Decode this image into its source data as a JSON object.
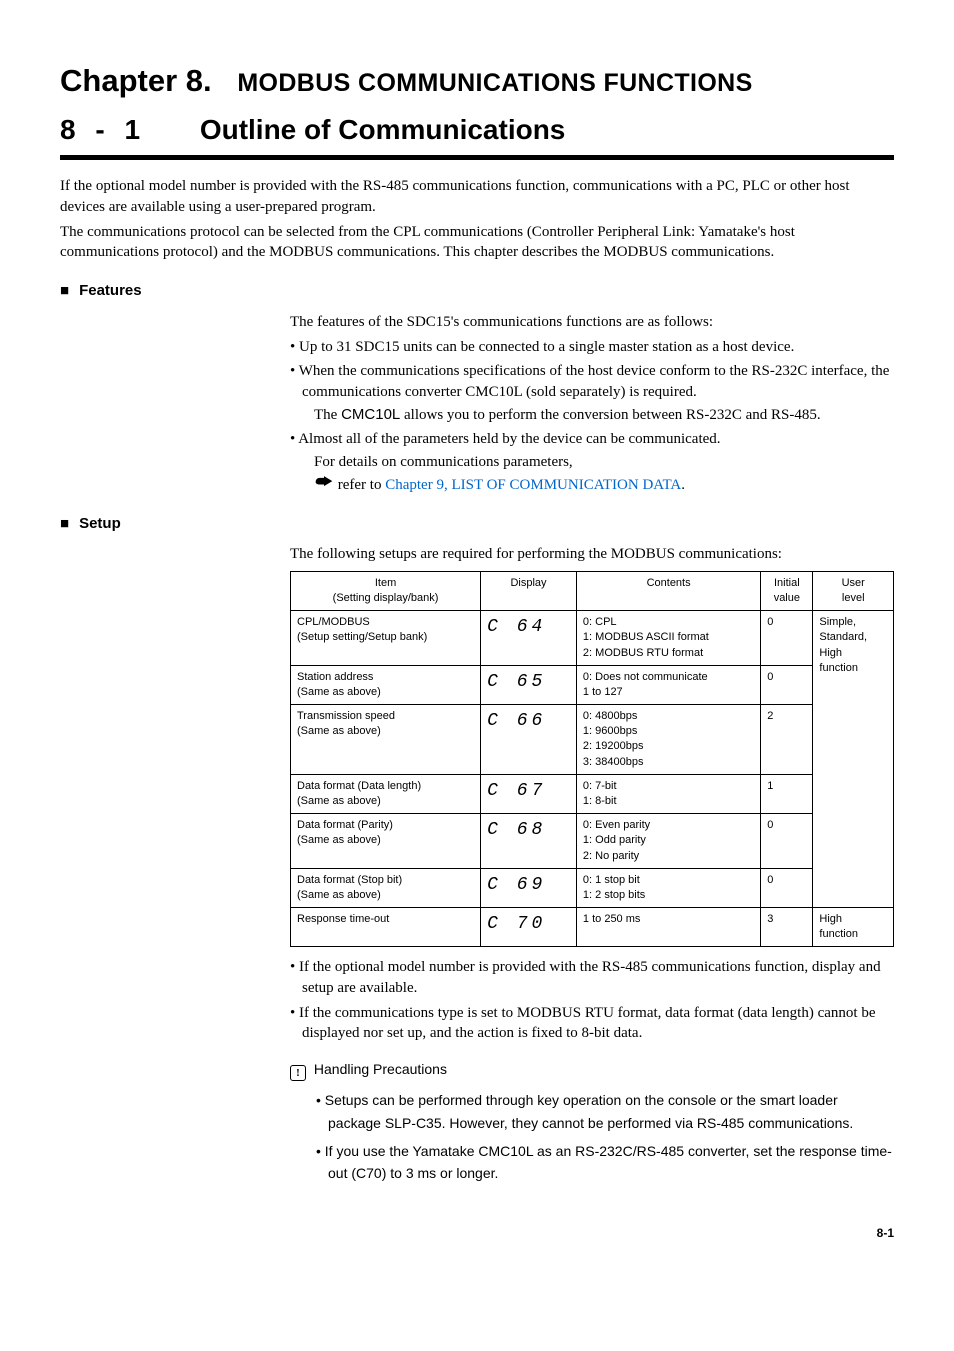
{
  "chapter": {
    "label": "Chapter 8.",
    "title": "MODBUS COMMUNICATIONS FUNCTIONS"
  },
  "section": {
    "number": "8 - 1",
    "title": "Outline of Communications"
  },
  "intro": {
    "p1": "If the optional model number is provided with the RS-485 communications function, communications with a PC, PLC or other host devices are available using a user-prepared program.",
    "p2": "The communications protocol can be selected from the CPL communications (Controller Peripheral Link: Yamatake's host communications protocol) and the MODBUS communications.  This chapter describes the MODBUS communications."
  },
  "features": {
    "heading": "Features",
    "lead": "The features of the SDC15's communications functions are as follows:",
    "bullets": {
      "b1": "Up to 31 SDC15 units can be connected to a single master station as a host device.",
      "b2_a": "When the communications specifications of the host device conform to the RS-232C interface, the communications converter CMC10L (sold separately) is required.",
      "b2_b_pre": "The ",
      "b2_b_sans": "CMC10L",
      "b2_b_post": " allows you to perform the conversion between RS-232C and RS-485.",
      "b3_a": "Almost all of the parameters held by the device can be communicated.",
      "b3_b": "For details on communications parameters,",
      "b3_ref_pre": "refer to ",
      "b3_ref_link": "Chapter 9, LIST OF COMMUNICATION DATA",
      "b3_ref_post": "."
    }
  },
  "setup": {
    "heading": "Setup",
    "lead": "The following setups are required for performing the MODBUS communications:",
    "headers": {
      "item_l1": "Item",
      "item_l2": "(Setting display/bank)",
      "display": "Display",
      "contents": "Contents",
      "initial_l1": "Initial",
      "initial_l2": "value",
      "user_l1": "User",
      "user_l2": "level"
    },
    "rows": [
      {
        "item_l1": "CPL/MODBUS",
        "item_l2": "(Setup setting/Setup bank)",
        "display": "C 64",
        "contents": "0: CPL\n1: MODBUS ASCII format\n2: MODBUS RTU format",
        "initial": "0",
        "user": "Simple,\nStandard,\nHigh\nfunction"
      },
      {
        "item_l1": "Station address",
        "item_l2": "(Same as above)",
        "display": "C 65",
        "contents": "0: Does not communicate\n1 to 127",
        "initial": "0"
      },
      {
        "item_l1": "Transmission speed",
        "item_l2": "(Same as above)",
        "display": "C 66",
        "contents": "0: 4800bps\n1: 9600bps\n2: 19200bps\n3: 38400bps",
        "initial": "2"
      },
      {
        "item_l1": "Data format (Data length)",
        "item_l2": "(Same as above)",
        "display": "C 67",
        "contents": "0: 7-bit\n1: 8-bit",
        "initial": "1"
      },
      {
        "item_l1": "Data format (Parity)",
        "item_l2": "(Same as above)",
        "display": "C 68",
        "contents": "0: Even parity\n1: Odd parity\n2: No parity",
        "initial": "0"
      },
      {
        "item_l1": "Data format (Stop bit)",
        "item_l2": "(Same as above)",
        "display": "C 69",
        "contents": "0: 1 stop bit\n1: 2 stop bits",
        "initial": "0"
      },
      {
        "item_l1": "Response time-out",
        "item_l2": "",
        "display": "C 70",
        "contents": "1 to 250 ms",
        "initial": "3",
        "user": "High\nfunction"
      }
    ],
    "notes": {
      "n1": "If the optional model number is provided with the RS-485 communications function, display and setup are available.",
      "n2": "If the communications type is set to MODBUS RTU format, data format (data length) cannot be displayed nor set up, and the action is fixed to 8-bit data."
    },
    "precautions": {
      "heading": "Handling Precautions",
      "items": {
        "i1": "Setups can be performed through key operation on the console or the smart loader package SLP-C35.  However, they cannot be performed via RS-485 communications.",
        "i2": "If you use the Yamatake CMC10L as an RS-232C/RS-485 converter, set the response time-out (C70) to 3 ms or longer."
      }
    }
  },
  "page_number": "8-1"
}
